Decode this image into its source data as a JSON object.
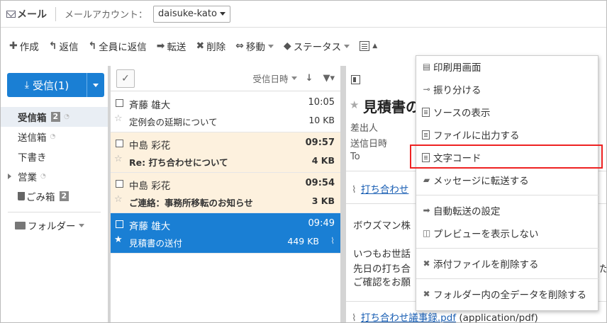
{
  "header": {
    "app_title": "メール",
    "account_label": "メールアカウント：",
    "account_value": "daisuke-kato"
  },
  "toolbar": {
    "compose": "作成",
    "reply": "返信",
    "reply_all": "全員に返信",
    "forward": "転送",
    "delete": "削除",
    "move": "移動",
    "status": "ステータス"
  },
  "sidebar": {
    "receive_label": "受信(1)",
    "folders": [
      {
        "label": "受信箱",
        "badge": "2"
      },
      {
        "label": "送信箱"
      },
      {
        "label": "下書き"
      },
      {
        "label": "営業"
      },
      {
        "label": "ごみ箱",
        "badge": "2"
      }
    ],
    "folder_menu": "フォルダー"
  },
  "list": {
    "sort_label": "受信日時",
    "rows": [
      {
        "sender": "斉藤 雄大",
        "time": "10:05",
        "subject": "定例会の延期について",
        "size": "10 KB"
      },
      {
        "sender": "中島 彩花",
        "time": "09:57",
        "subject": "Re: 打ち合わせについて",
        "size": "4 KB"
      },
      {
        "sender": "中島 彩花",
        "time": "09:54",
        "subject": "ご連絡：事務所移転のお知らせ",
        "size": "3 KB"
      },
      {
        "sender": "斉藤 雄大",
        "time": "09:49",
        "subject": "見積書の送付",
        "size": "449 KB"
      }
    ]
  },
  "preview": {
    "title": "見積書の",
    "from_label": "差出人",
    "date_label": "送信日時",
    "to_label": "To",
    "attach_top": "打ち合わせ",
    "body1": "ボウズマン株",
    "body2": "いつもお世話",
    "body3": "先日の打ち合",
    "body4": "ご確認をお願",
    "body3_tail": "た",
    "attach_bottom_link": "打ち合わせ議事録.pdf",
    "attach_bottom_type": "(application/pdf)"
  },
  "dropdown": {
    "items": [
      "印刷用画面",
      "振り分ける",
      "ソースの表示",
      "ファイルに出力する",
      "文字コード",
      "メッセージに転送する",
      "自動転送の設定",
      "プレビューを表示しない",
      "添付ファイルを削除する",
      "フォルダー内の全データを削除する"
    ]
  },
  "colors": {
    "accent": "#1a7fd4",
    "unread_bg": "#fdf1de",
    "highlight": "#ee2222"
  }
}
